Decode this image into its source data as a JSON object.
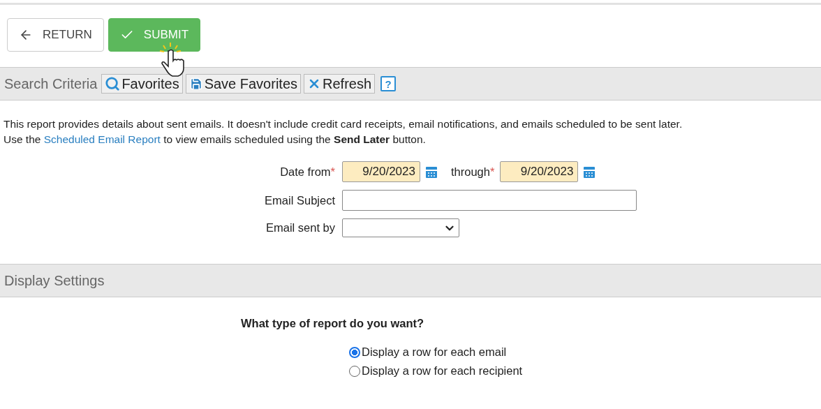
{
  "toolbar": {
    "buttons": [
      {
        "kind": "return",
        "label": "RETURN"
      },
      {
        "kind": "submit",
        "label": "SUBMIT"
      }
    ]
  },
  "search_criteria": {
    "title": "Search Criteria",
    "buttons": [
      {
        "kind": "search",
        "label": "Favorites"
      },
      {
        "kind": "save",
        "label": "Save Favorites"
      },
      {
        "kind": "refresh",
        "label": "Refresh"
      },
      {
        "kind": "help",
        "label": "?"
      }
    ]
  },
  "description": {
    "line1": "This report provides details about sent emails. It doesn't include credit card receipts, email notifications, and emails scheduled to be sent later.",
    "line2_before": "Use the",
    "link": "Scheduled Email Report",
    "line2_after": "to view emails scheduled using the **Send Later** button."
  },
  "form": {
    "date_from": {
      "label": "Date from",
      "required_mark": "*",
      "value": "9/20/2023"
    },
    "through": {
      "label": "through",
      "required_mark": "*",
      "value": "9/20/2023"
    },
    "email_subject": {
      "label": "Email Subject"
    },
    "email_sent_by": {
      "label": "Email sent by"
    }
  },
  "display_settings": {
    "title": "Display Settings",
    "question": "What type of report do you want?",
    "options": [
      {
        "label": "Display a row for each email",
        "selected": true
      },
      {
        "label": "Display a row for each recipient",
        "selected": false
      }
    ]
  }
}
